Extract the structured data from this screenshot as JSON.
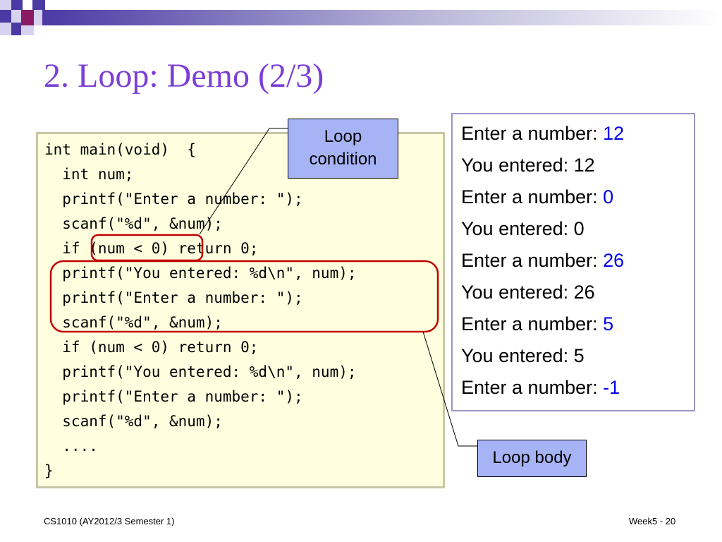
{
  "slide": {
    "title": "2. Loop: Demo (2/3)",
    "colors": {
      "title": "#7b3fd6",
      "code_bg": "#ffffe0",
      "callout_bg": "#a6b3f5",
      "input_value": "#0000ee",
      "highlight_outline": "#c00000"
    }
  },
  "code": {
    "lines": [
      "int main(void)  {",
      "  int num;",
      "  printf(\"Enter a number: \");",
      "  scanf(\"%d\", &num);",
      "  if (num < 0) return 0;",
      "  printf(\"You entered: %d\\n\", num);",
      "  printf(\"Enter a number: \");",
      "  scanf(\"%d\", &num);",
      "  if (num < 0) return 0;",
      "  printf(\"You entered: %d\\n\", num);",
      "  printf(\"Enter a number: \");",
      "  scanf(\"%d\", &num);",
      "  ....",
      "}"
    ]
  },
  "output": {
    "lines": [
      {
        "text": "Enter a number: ",
        "input": "12"
      },
      {
        "text": "You entered: 12"
      },
      {
        "text": "Enter a number: ",
        "input": "0"
      },
      {
        "text": "You entered: 0"
      },
      {
        "text": "Enter a number: ",
        "input": "26"
      },
      {
        "text": "You entered: 26"
      },
      {
        "text": "Enter a number: ",
        "input": "5"
      },
      {
        "text": "You entered: 5"
      },
      {
        "text": "Enter a number: ",
        "input": "-1"
      }
    ]
  },
  "callouts": {
    "loop_condition": {
      "line1": "Loop",
      "line2": "condition"
    },
    "loop_body": "Loop body"
  },
  "footer": {
    "course": "CS1010 (AY2012/3 Semester 1)",
    "page": "Week5 - 20"
  }
}
